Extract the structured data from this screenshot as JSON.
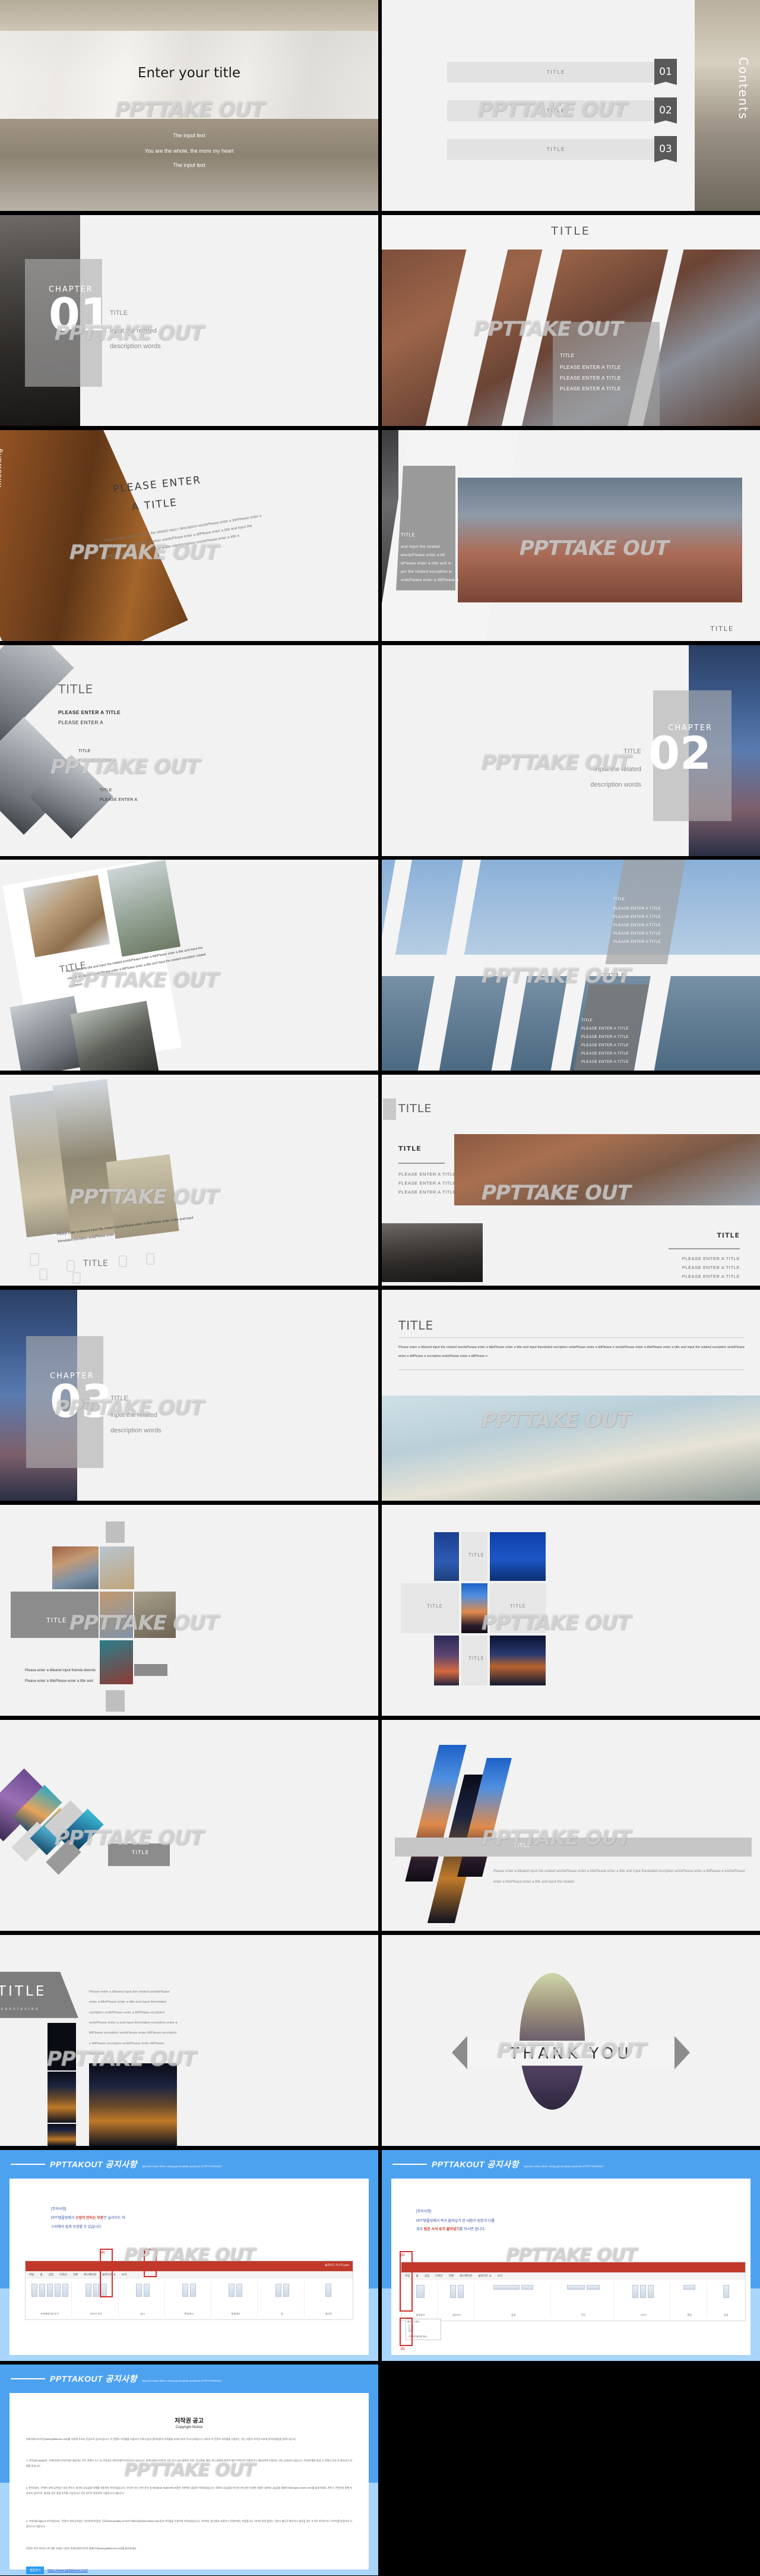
{
  "meta": {
    "watermark": "PPTTAKEOUT",
    "watermark_part1": "PPT",
    "watermark_part2": "TAKE OUT",
    "accent_blue": "#4da2f0",
    "accent_grey": "#8c8c8c",
    "page_bg": "#000000",
    "slide_bg": "#f2f2f2"
  },
  "slides": [
    {
      "id": "cover",
      "title": "Enter your title",
      "sub1": "The input text",
      "sub2": "You are the whole, the more my heart",
      "sub3": "The input text"
    },
    {
      "id": "contents",
      "side_word": "Contents",
      "items": [
        {
          "label": "TITLE",
          "num": "01"
        },
        {
          "label": "TITLE",
          "num": "02"
        },
        {
          "label": "TITLE",
          "num": "03"
        }
      ]
    },
    {
      "id": "chapter-01",
      "chapter_word": "CHAPTER",
      "chapter_num": "01",
      "side_title": "TITLE",
      "side_line1": "input the related",
      "side_line2": "description words"
    },
    {
      "id": "title-diagonal",
      "header": "TITLE",
      "list": [
        "TITLE",
        "PLEASE ENTER A TITLE",
        "PLEASE ENTER A TITLE",
        "PLEASE ENTER A TITLE"
      ]
    },
    {
      "id": "please-enter-a-title",
      "photo_word": "misswang",
      "title_line1": "PLEASE  ENTER",
      "title_line2": "A TITLE",
      "body": "Please enter a title and input the related input t description  wordsPlease  enter  a  titlePlease enter  a  title  and  input  the  related  escription wordsPlease enter a titlPlease enter a title and input  the  rotedescription  wordsPlease  enter  a title rotedescription wordsPlease enter a title a"
    },
    {
      "id": "grey-trapezoid",
      "title": "TITLE",
      "body_lines": [
        "and input the related",
        " wordsPlease enter a titl",
        "ePlease enter a title and in",
        "put the related escription w",
        "ordsPlease enter a titlPlease e"
      ],
      "bottom_title": "TITLE"
    },
    {
      "id": "diamond-list",
      "title": "TITLE",
      "l1a": "PLEASE ENTER A TITLE",
      "l1b": "PLEASE ENTER A",
      "l2t": "TITLE",
      "l2b": "PLEASE ENTER A",
      "l3t": "TITLE",
      "l3b": "PLEASE ENTER A"
    },
    {
      "id": "chapter-02",
      "chapter_word": "CHAPTER",
      "chapter_num": "02",
      "side_title": "TITLE",
      "side_line1": "input the related",
      "side_line2": "description words"
    },
    {
      "id": "tilted-photos",
      "title": "TITLE",
      "body": "Please  enter  a  title  and  input  the  related  wordsPlease enter a titlePlease enter a title and input the related escription wordsPlease enter a titlPlease enter a title and input the related escription related escription"
    },
    {
      "id": "skew-columns",
      "title_top": "TITLE",
      "list_top": [
        "PLEASE ENTER A TITLE",
        "PLEASE ENTER A TITLE",
        "PLEASE ENTER A TITLE",
        "PLEASE ENTER A TITLE",
        "PLEASE ENTER A TITLE"
      ],
      "title_mid": "TITLE",
      "title_bot": "TITLE",
      "list_bot": [
        "PLEASE ENTER A TITLE",
        "PLEASE ENTER A TITLE",
        "PLEASE ENTER A TITLE",
        "PLEASE ENTER A TITLE",
        "PLEASE ENTER A TITLE"
      ]
    },
    {
      "id": "louvre-collage",
      "body": "Please enter a titleand  input the  related  wordsPlease enter a titlePlease enter a title and input therelated escription wrdsPlease enter",
      "title": "TITLE"
    },
    {
      "id": "two-panel-title",
      "header": "TITLE",
      "block1_title": "TITLE",
      "block1_list": [
        "PLEASE  ENTER  A  TITLE",
        "PLEASE  ENTER  A  TITLE",
        "PLEASE  ENTER  A  TITLE"
      ],
      "block2_title": "TITLE",
      "block2_list": [
        "PLEASE  ENTER  A  TITLE",
        "PLEASE  ENTER  A  TITLE",
        "PLEASE  ENTER  A  TITLE"
      ]
    },
    {
      "id": "chapter-03",
      "chapter_word": "CHAPTER",
      "chapter_num": "03",
      "side_title": "TITLE",
      "side_line1": "input the related",
      "side_line2": "description words"
    },
    {
      "id": "text-over-photo",
      "title": "TITLE",
      "body": "Please enter a titleand input the related wordsPlease enter a titlePlease enter a title and input therelated escription wrdsPlease  enter  a  titlPlease  e  wordsPlease  enter  a  titlePlease  enter  a  title  and  input  the related escription wrdsPlease enter a titlPlease e escription wrdsPlease enter a titlPlease e"
    },
    {
      "id": "mosaic-venice",
      "title": "TITLE",
      "body1": "Please enter a titleand input therela dwords",
      "body2": "Please enter a titlePlease enter a  title  and"
    },
    {
      "id": "mosaic-blue",
      "t1": "TITLE",
      "t2": "TITLE",
      "t3": "TITLE",
      "t4": "TITLE"
    },
    {
      "id": "diamond-strip",
      "title": "TITLE"
    },
    {
      "id": "skew-city",
      "title": "TITLE",
      "body": "Please enter a titleand input the related wordsPlease enter  a  titlePlease  enter  a  title  and  input  therelated escription  wrdsPlease  enter  a  titlPlease  e  wordsPlease enter a titlePlease enter a title and input the related"
    },
    {
      "id": "conclusion",
      "title": "TITLE",
      "subtitle": "c o n c l u s i o n",
      "body": "Please enter a titleand input the related wordsPlease enter a titlePlease  enter  a  title  and  input  therelated  escription wrdsPlease enter a titlPlease escription wrdsPlease enter a and input therelated escription  enter a titlPlease escription wrdsPlease enter titlPlease escription a titlPlease escription wrdsPlease enter titlPlease escription"
    },
    {
      "id": "thank-you",
      "text": "THANK YOU"
    },
    {
      "id": "notice-1",
      "header_title": "PPTTAKOUT 공지사항",
      "header_sub": "Special notice when using ppt template products of PPTTAKEOUT",
      "note_head": "[주의사항]",
      "note_l1_a": "PPT템플릿에서 ",
      "note_l1_b": "수정이 안되는 부분",
      "note_l1_c": "은 슬라이드 마",
      "note_l2": "스터에서 쉽게 수정할 수 있습니다.",
      "ui_file": "슬라이드 마스터.pptx",
      "marks": [
        "(1)",
        "(2)"
      ],
      "tabs": [
        "파일",
        "홈",
        "삽입",
        "디자인",
        "전환",
        "애니메이션",
        "슬라이드 쇼",
        "보기"
      ],
      "groups": [
        "프레젠테이션 보기",
        "마스터 보기",
        "표시",
        "확대/축소",
        "색/회색조",
        "창",
        "매크로"
      ]
    },
    {
      "id": "notice-2",
      "header_title": "PPTTAKOUT 공지사항",
      "header_sub": "Special notice when using ppt template products of PPTTAKEOUT",
      "note_head": "[주의사항]",
      "note_l1": "PPT템플릿에서 복사 붙여넣기 한 내용이 원본과 다를",
      "note_l2_a": "경우 ",
      "note_l2_b": "원본 서식 유지 붙여넣기",
      "note_l2_c": "를 하시면 됩니다.",
      "marks": [
        "(1)",
        "(2)"
      ],
      "tabs": [
        "파일",
        "홈",
        "삽입",
        "디자인",
        "전환",
        "애니메이션",
        "슬라이드 쇼",
        "보기"
      ],
      "paste_label": "붙여넣기",
      "menu_title": "붙여넣기 옵션:",
      "menu_item": "선택하여 붙여넣기(S)...",
      "groups": [
        "클립보드",
        "슬라이드",
        "글꼴",
        "단락",
        "그리기",
        "편집",
        "음성"
      ]
    },
    {
      "id": "notice-copyright",
      "header_title": "PPTTAKOUT 공지사항",
      "header_sub": "Special notice when using ppt template products of PPTTAKEOUT",
      "doc_title": "저작권 공고",
      "doc_subtitle": "Copyright Notice",
      "p0": "피피티테이크아웃(www.ppttakeout.com)를 이용해 주셔서 진심으로 감사드립니다. 이 콘텐츠 저작물을 사용하기 전에 다음의 협의사항과 저작물을 자세히 읽어 주시기 바랍니다. 귀하가 이 콘텐츠 저작물을 사용하는 것은 사용자 저작권 보호에 동의하셨음을 알려드립니다.",
      "p1": "1. 저작권(copyright) : 피피티테이크아웃에서 제공하는 모든 콘텐츠 소스 및 저작권은 피피티테이크아웃자가 있습니다. 피피티테이크아웃의 사전 승낙 없이 불법적 이용, 무단전재, 배포 기타 방법에 의하여 명의 목적으로 이용하거나 제3자에게 이용하는 것은 금지되어 있습니다. 이러한 행위 발생 시 민형사 민사 및 형사상의 처벌을 받습니다.",
      "p2": "2. 폰트(font) : 콘텐츠 내에 담겨있는 일부 폰트는 네이버 나눔글꼴 서체를 이용하여 저작되었습니다. 한국어 또는 로마 문자 및 Windows System에 포함된 기본적인 글꼴로 저작되었습니다. 네이버 나눔글꼴 라이선스에 대한 자세한 사항은 네이버 나눔글꼴 홈페이지(hangeul.naver.com)를 참조하세요. 폰트는 콘텐츠와 함께 저장되지 않으므로, 필요할 경우 정품 폰트를 구입하거나 다른 폰트로 변경하여 사용하시기 바랍니다.",
      "p3": "3. 이미지(image) & 아이콘(icon) : 콘텐츠 내에 담겨있는 이미지(아이콘)은 무료(www.pixabay.com)와 Videvo(s)(www.videvo.net) 등의 저작물을 이용하여 저작되었습니다. 이미지는 참고용과 저장하고 콘텐츠에는 포함됩니다. 이미지 관련 출처는 귀하가 별도로 확인하고 필요할 경우 추가로 저작하거나 이미지를 변경하여 사용하시기 바랍니다.",
      "p4": "콘텐츠 저작 라이선스에 대한 자세한 사항은 피피티테이크아웃 홈페이지(www.ppttakeout.com)를 참조하세요.",
      "btn_label": "방문하기",
      "btn_url": "https://www.ppttakeout.com/"
    },
    {
      "id": "blank",
      "text": ""
    }
  ]
}
